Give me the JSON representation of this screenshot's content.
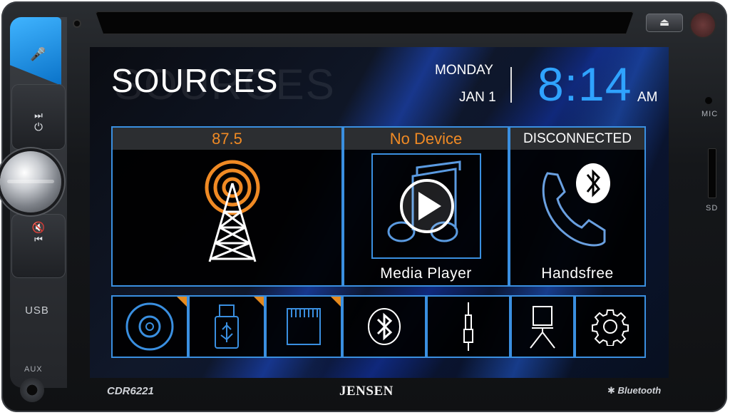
{
  "screen": {
    "title": "SOURCES",
    "day": "MONDAY",
    "date": "JAN 1",
    "time": "8:14",
    "ampm": "AM"
  },
  "tiles": {
    "radio": {
      "header": "87.5",
      "header_color": "#f08a24"
    },
    "media": {
      "header": "No Device",
      "header_color": "#f08a24",
      "label": "Media Player"
    },
    "handsfree": {
      "header": "DISCONNECTED",
      "header_color": "#ffffff",
      "label": "Handsfree"
    }
  },
  "source_icons": [
    "disc-icon",
    "usb-icon",
    "sd-card-icon",
    "bluetooth-icon",
    "aux-jack-icon",
    "camera-icon",
    "settings-gear-icon"
  ],
  "hardware": {
    "mic_label": "MIC",
    "sd_label": "SD",
    "usb_label": "USB",
    "aux_label": "AUX",
    "model": "CDR6221",
    "brand": "JENSEN",
    "bluetooth_badge": "Bluetooth"
  },
  "colors": {
    "accent_blue": "#2fa3ff",
    "tile_border": "#3a8fe0",
    "orange": "#f08a24"
  }
}
